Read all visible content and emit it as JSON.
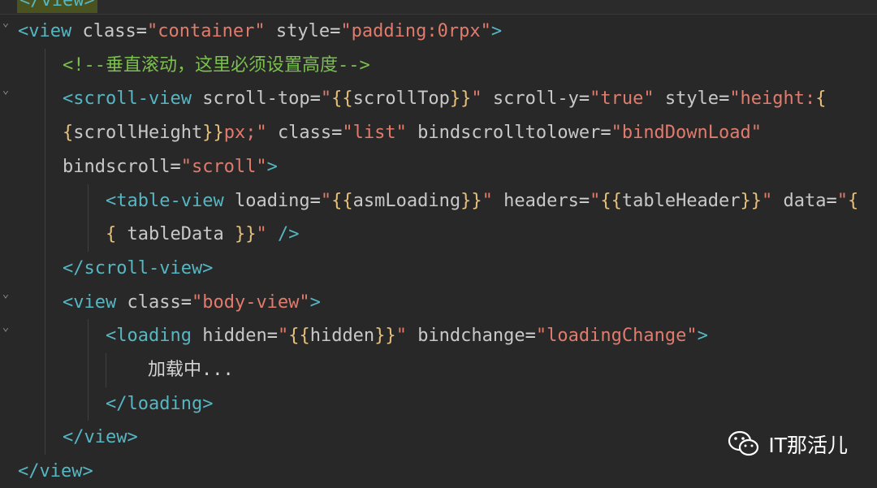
{
  "top_clip_text": "</view>",
  "lines": [
    {
      "tokens": [
        {
          "t": "t",
          "x": "<view"
        },
        {
          "t": "p",
          "x": " "
        },
        {
          "t": "a",
          "x": "class"
        },
        {
          "t": "p",
          "x": "="
        },
        {
          "t": "s",
          "x": "\"container\""
        },
        {
          "t": "p",
          "x": " "
        },
        {
          "t": "a",
          "x": "style"
        },
        {
          "t": "p",
          "x": "="
        },
        {
          "t": "s",
          "x": "\"padding:0rpx\""
        },
        {
          "t": "t",
          "x": ">"
        }
      ]
    },
    {
      "tokens": [
        {
          "t": "c",
          "x": "<!--垂直滚动，这里必须设置高度-->"
        }
      ]
    },
    {
      "tokens": [
        {
          "t": "t",
          "x": "<scroll-view"
        },
        {
          "t": "p",
          "x": " "
        },
        {
          "t": "a",
          "x": "scroll-top"
        },
        {
          "t": "p",
          "x": "="
        },
        {
          "t": "s",
          "x": "\""
        },
        {
          "t": "b",
          "x": "{{"
        },
        {
          "t": "v",
          "x": "scrollTop"
        },
        {
          "t": "b",
          "x": "}}"
        },
        {
          "t": "s",
          "x": "\""
        },
        {
          "t": "p",
          "x": " "
        },
        {
          "t": "a",
          "x": "scroll-y"
        },
        {
          "t": "p",
          "x": "="
        },
        {
          "t": "s",
          "x": "\"true\""
        },
        {
          "t": "p",
          "x": " "
        },
        {
          "t": "a",
          "x": "style"
        },
        {
          "t": "p",
          "x": "="
        },
        {
          "t": "s",
          "x": "\"height:"
        },
        {
          "t": "b",
          "x": "{"
        }
      ]
    },
    {
      "tokens": [
        {
          "t": "b",
          "x": "{"
        },
        {
          "t": "v",
          "x": "scrollHeight"
        },
        {
          "t": "b",
          "x": "}}"
        },
        {
          "t": "s",
          "x": "px;\""
        },
        {
          "t": "p",
          "x": " "
        },
        {
          "t": "a",
          "x": "class"
        },
        {
          "t": "p",
          "x": "="
        },
        {
          "t": "s",
          "x": "\"list\""
        },
        {
          "t": "p",
          "x": " "
        },
        {
          "t": "a",
          "x": "bindscrolltolower"
        },
        {
          "t": "p",
          "x": "="
        },
        {
          "t": "s",
          "x": "\"bindDownLoad\""
        }
      ]
    },
    {
      "tokens": [
        {
          "t": "a",
          "x": "bindscroll"
        },
        {
          "t": "p",
          "x": "="
        },
        {
          "t": "s",
          "x": "\"scroll\""
        },
        {
          "t": "t",
          "x": ">"
        }
      ]
    },
    {
      "tokens": [
        {
          "t": "t",
          "x": "<table-view"
        },
        {
          "t": "p",
          "x": " "
        },
        {
          "t": "a",
          "x": "loading"
        },
        {
          "t": "p",
          "x": "="
        },
        {
          "t": "s",
          "x": "\""
        },
        {
          "t": "b",
          "x": "{{"
        },
        {
          "t": "v",
          "x": "asmLoading"
        },
        {
          "t": "b",
          "x": "}}"
        },
        {
          "t": "s",
          "x": "\""
        },
        {
          "t": "p",
          "x": " "
        },
        {
          "t": "a",
          "x": "headers"
        },
        {
          "t": "p",
          "x": "="
        },
        {
          "t": "s",
          "x": "\""
        },
        {
          "t": "b",
          "x": "{{"
        },
        {
          "t": "v",
          "x": "tableHeader"
        },
        {
          "t": "b",
          "x": "}}"
        },
        {
          "t": "s",
          "x": "\""
        },
        {
          "t": "p",
          "x": " "
        },
        {
          "t": "a",
          "x": "data"
        },
        {
          "t": "p",
          "x": "="
        },
        {
          "t": "s",
          "x": "\""
        },
        {
          "t": "b",
          "x": "{"
        }
      ]
    },
    {
      "tokens": [
        {
          "t": "b",
          "x": "{"
        },
        {
          "t": "p",
          "x": " "
        },
        {
          "t": "v",
          "x": "tableData"
        },
        {
          "t": "p",
          "x": " "
        },
        {
          "t": "b",
          "x": "}}"
        },
        {
          "t": "s",
          "x": "\""
        },
        {
          "t": "p",
          "x": " "
        },
        {
          "t": "t",
          "x": "/>"
        }
      ]
    },
    {
      "tokens": [
        {
          "t": "t",
          "x": "</scroll-view>"
        }
      ]
    },
    {
      "tokens": [
        {
          "t": "t",
          "x": "<view"
        },
        {
          "t": "p",
          "x": " "
        },
        {
          "t": "a",
          "x": "class"
        },
        {
          "t": "p",
          "x": "="
        },
        {
          "t": "s",
          "x": "\"body-view\""
        },
        {
          "t": "t",
          "x": ">"
        }
      ]
    },
    {
      "tokens": [
        {
          "t": "t",
          "x": "<loading"
        },
        {
          "t": "p",
          "x": " "
        },
        {
          "t": "a",
          "x": "hidden"
        },
        {
          "t": "p",
          "x": "="
        },
        {
          "t": "s",
          "x": "\""
        },
        {
          "t": "b",
          "x": "{{"
        },
        {
          "t": "v",
          "x": "hidden"
        },
        {
          "t": "b",
          "x": "}}"
        },
        {
          "t": "s",
          "x": "\""
        },
        {
          "t": "p",
          "x": " "
        },
        {
          "t": "a",
          "x": "bindchange"
        },
        {
          "t": "p",
          "x": "="
        },
        {
          "t": "s",
          "x": "\"loadingChange\""
        },
        {
          "t": "t",
          "x": ">"
        }
      ]
    },
    {
      "tokens": [
        {
          "t": "p",
          "x": "加载中..."
        }
      ]
    },
    {
      "tokens": [
        {
          "t": "t",
          "x": "</loading>"
        }
      ]
    },
    {
      "tokens": [
        {
          "t": "t",
          "x": "</view>"
        }
      ]
    },
    {
      "tokens": [
        {
          "t": "t",
          "x": "</view>"
        }
      ]
    }
  ],
  "fold_markers": [
    "chevron-down",
    "chevron-down",
    "chevron-down",
    "chevron-down"
  ],
  "watermark": {
    "icon": "wechat-icon",
    "text": "IT那活儿"
  },
  "colors": {
    "background": "#282828",
    "tag": "#56b6c2",
    "attribute": "#c8c8c8",
    "string": "#e07b6d",
    "brace": "#e5c07b",
    "comment": "#7bbf4f"
  }
}
